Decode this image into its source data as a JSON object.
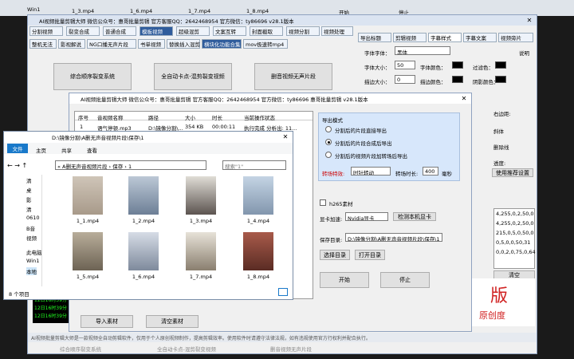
{
  "desktop_top": {
    "items": [
      "Win1",
      "1_3.mp4",
      "1_6.mp4",
      "1_7.mp4",
      "1_8.mp4",
      "开始",
      "停止"
    ]
  },
  "main": {
    "title": "AI视频批量剪辑大师  微信公众号：惠哥批量剪辑  官方客服QQ：2642468954  官方微信：ty86696   v28.1版本",
    "toolbar": [
      "分割视频",
      "裂变合成",
      "普通合成",
      "模板视频",
      "超级混剪",
      "文案互转",
      "封面截取",
      "视频分割",
      "视频处理"
    ],
    "subtabs": [
      "整机无法",
      "影视解说",
      "NG口播无声片段",
      "书单视频",
      "替换插入混剪",
      "横块化功能合集",
      "mov极速转mp4"
    ],
    "big_buttons": [
      "综合顺序裂变系统",
      "全自动卡点-混剪裂变视频",
      "删音视频无声片段"
    ],
    "right_tabs": [
      "导出标题",
      "剪辑视频",
      "字幕样式",
      "字幕文案",
      "视频旁片"
    ],
    "font_label": "字体字体：",
    "font_value": "黑体",
    "font_size_label": "字体大小：",
    "font_size_value": "50",
    "font_color_label": "字体颜色：",
    "stroke_color_label": "过滤色：",
    "stroke_label": "描边大小：",
    "stroke_value": "0",
    "bg_color_label": "描边颜色：",
    "shadow_label": "阴影颜色：",
    "help": "说明",
    "right_more": [
      "右边距:",
      "斜体",
      "删除线",
      "透度:"
    ],
    "recommend_btn": "使用推荐设置",
    "codes": [
      "4,255,0,2,50,0",
      "4,255,0,2,50,0",
      "215,0,5,0,50,0",
      "0,5,0,0,50,31",
      "0,0,2,0,75,0,64"
    ],
    "clear_btn": "清空",
    "red_text_1": "版",
    "red_text_2": "原创度",
    "bottom_items": [
      "综合顺序裂变系统",
      "全自动卡点-混剪裂变视频",
      "删音视频无声片段"
    ],
    "bottom_desc": "AI视频批量剪辑大师是一款视频全自动剪辑软件，仅用于个人原创视频制作，提高剪辑效率。使用软件时请遵守法律法规，如有违规使用官方行权利并配合执行。"
  },
  "dialog": {
    "title": "AI视频批量剪辑大师  微信公众号：惠哥批量剪辑  官方客服QQ：2642468954  官方微信：ty86696   惠哥批量剪辑  v28.1版本",
    "table_headers": [
      "序号",
      "音视频名称",
      "路径",
      "大小",
      "时长",
      "当前操作状态"
    ],
    "table_row": [
      "1",
      "语气停顿.mp3",
      "D:\\镜像分割\\...",
      "354 KB",
      "00:00:11",
      "执行完成 分析出: 11..."
    ],
    "import_btn": "导入素材",
    "clear_btn": "清空素材",
    "export_mode": "导出模式",
    "options": [
      "分割后的片段直接导出",
      "分割后的片段合成后导出",
      "分割后的视频片段加转场后导出"
    ],
    "selected_option": 1,
    "transition_label": "转场特效:",
    "transition_value": "时针转动",
    "transition_duration_label": "转场时长:",
    "transition_duration_value": "400",
    "ms": "毫秒",
    "h265": "h265素材",
    "gpu_label": "显卡加速:",
    "gpu_value": "Nvidia显卡",
    "detect_btn": "检测本机显卡",
    "save_label": "保存目录:",
    "save_path": "D:\\镜像分割\\A删无声音视频片段\\保存\\1",
    "choose_dir": "选择目录",
    "open_dir": "打开目录",
    "start_btn": "开始",
    "stop_btn": "停止"
  },
  "explorer": {
    "title": "D:\\镜像分割\\A删无声音视频片段\\保存\\1",
    "ribbon": [
      "文件",
      "主页",
      "共享",
      "查看"
    ],
    "breadcrumb": "« A删无声音视频片段 › 保存 › 1",
    "search_placeholder": "搜索\"1\"",
    "nav": [
      "清",
      "桌",
      "影",
      "清",
      "0610",
      "B音",
      "视频",
      "此电脑",
      "Win1",
      "本地"
    ],
    "files": [
      "1_1.mp4",
      "1_2.mp4",
      "1_3.mp4",
      "1_4.mp4",
      "1_5.mp4",
      "1_6.mp4",
      "1_7.mp4",
      "1_8.mp4"
    ],
    "status": "8 个项目"
  },
  "console": {
    "lines": [
      "12日16时39分",
      "12日16时39分",
      "12日16时39分"
    ]
  }
}
